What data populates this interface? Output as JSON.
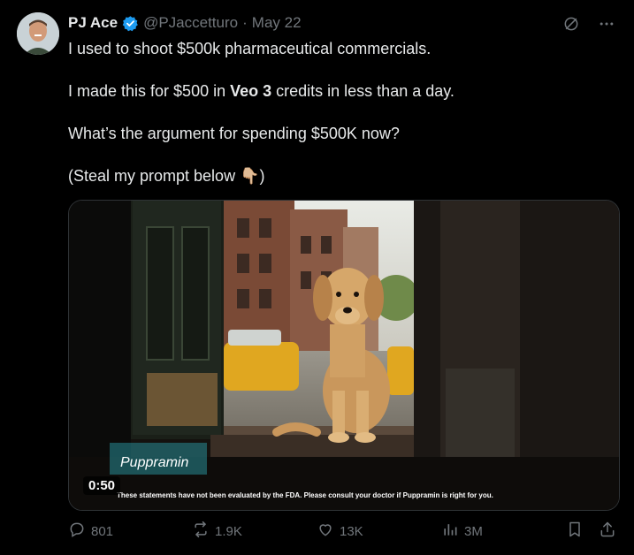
{
  "author": {
    "display_name": "PJ Ace",
    "handle": "@PJaccetturo",
    "separator": "·",
    "date": "May 22",
    "avatar_icon": "profile-photo",
    "verified_icon": "verified-badge-icon",
    "verified_color": "#1d9bf0"
  },
  "top_actions": {
    "grok_icon": "grok-icon",
    "more_icon": "more-options-icon"
  },
  "tweet": {
    "line1": "I used to shoot $500k pharmaceutical commercials.",
    "line2_prefix": "I made this for $500 in ",
    "line2_bold": "Veo 3",
    "line2_suffix": " credits in less than a day.",
    "line3": "What’s the argument for spending $500K now?",
    "line4_prefix": "(Steal my prompt below ",
    "line4_emoji": "👇🏼",
    "line4_suffix": ")"
  },
  "video": {
    "caption_brand": "Puppramin",
    "disclaimer": "These statements have not been evaluated by the FDA. Please consult your doctor if Puppramin is right for you.",
    "duration": "0:50"
  },
  "engagement": {
    "replies": "801",
    "reposts": "1.9K",
    "likes": "13K",
    "views": "3M",
    "reply_icon": "reply-icon",
    "repost_icon": "repost-icon",
    "like_icon": "like-icon",
    "views_icon": "views-icon",
    "bookmark_icon": "bookmark-icon",
    "share_icon": "share-icon"
  },
  "colors": {
    "background": "#000000",
    "text_primary": "#e7e9ea",
    "text_secondary": "#71767b",
    "accent": "#1d9bf0"
  }
}
